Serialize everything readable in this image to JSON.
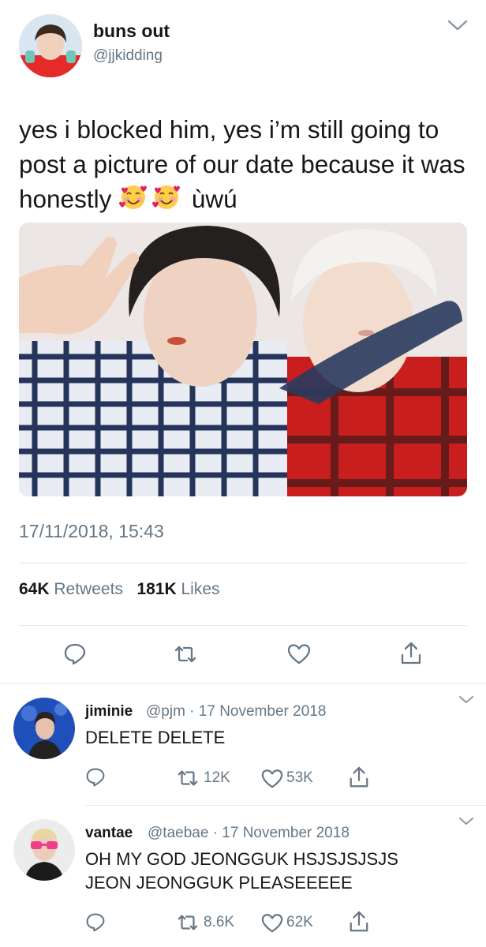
{
  "tweet": {
    "display_name": "buns out",
    "handle": "@jjkidding",
    "text": "yes i blocked him, yes i’m still going to post a picture of our date because it was honestly",
    "text_suffix": "ùwú",
    "emoji": [
      "smiling-face-with-hearts",
      "smiling-face-with-hearts"
    ],
    "timestamp": "17/11/2018, 15:43",
    "retweets_count": "64K",
    "retweets_label": "Retweets",
    "likes_count": "181K",
    "likes_label": "Likes"
  },
  "replies": [
    {
      "display_name": "jiminie",
      "meta": "@pjm · 17 November 2018",
      "text": "DELETE DELETE",
      "retweets": "12K",
      "likes": "53K"
    },
    {
      "display_name": "vantae",
      "meta": "@taebae · 17 November 2018",
      "text_line1": "OH MY GOD JEONGGUK HSJSJSJSJS",
      "text_line2": "JEON JEONGGUK PLEASEEEEE",
      "retweets": "8.6K",
      "likes": "62K"
    }
  ],
  "colors": {
    "text": "#14171a",
    "secondary": "#657786",
    "divider": "#e1e8ed"
  }
}
